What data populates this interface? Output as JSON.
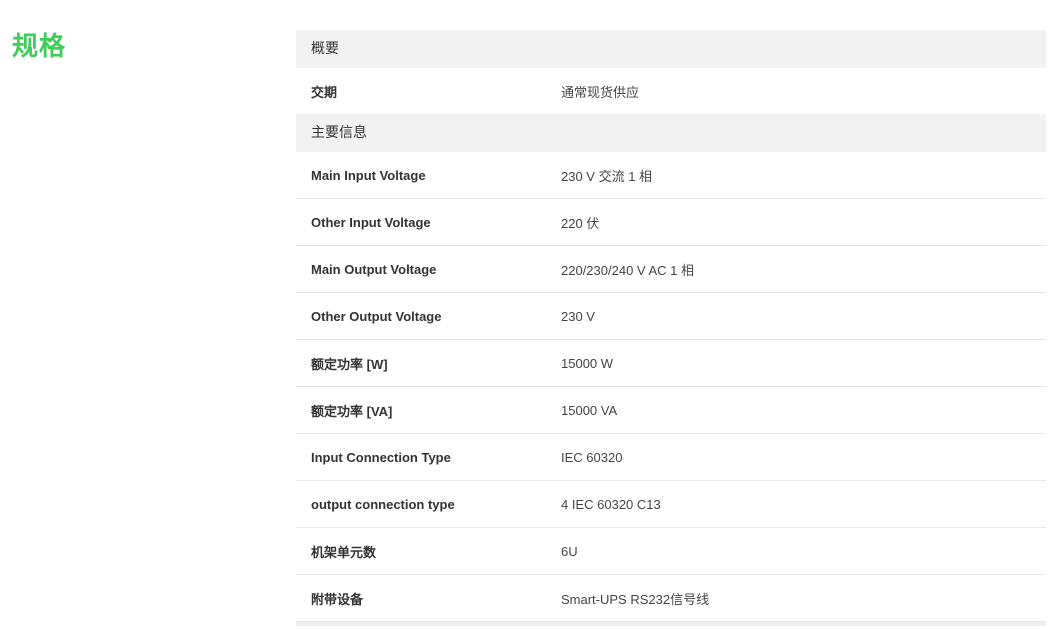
{
  "section_title": "规格",
  "groups": [
    {
      "header": "概要",
      "rows": [
        {
          "label": "交期",
          "value": "通常现货供应"
        }
      ]
    },
    {
      "header": "主要信息",
      "rows": [
        {
          "label": "Main Input Voltage",
          "value": "230 V 交流 1 相"
        },
        {
          "label": "Other Input Voltage",
          "value": "220 伏"
        },
        {
          "label": "Main Output Voltage",
          "value": "220/230/240 V AC 1 相"
        },
        {
          "label": "Other Output Voltage",
          "value": "230 V"
        },
        {
          "label": "额定功率 [W]",
          "value": "15000 W"
        },
        {
          "label": "额定功率 [VA]",
          "value": "15000 VA"
        },
        {
          "label": "Input Connection Type",
          "value": "IEC 60320"
        },
        {
          "label": "output connection type",
          "value": "4 IEC 60320 C13"
        },
        {
          "label": "机架单元数",
          "value": "6U"
        },
        {
          "label": "附带设备",
          "value": "Smart-UPS RS232信号线"
        }
      ]
    }
  ]
}
